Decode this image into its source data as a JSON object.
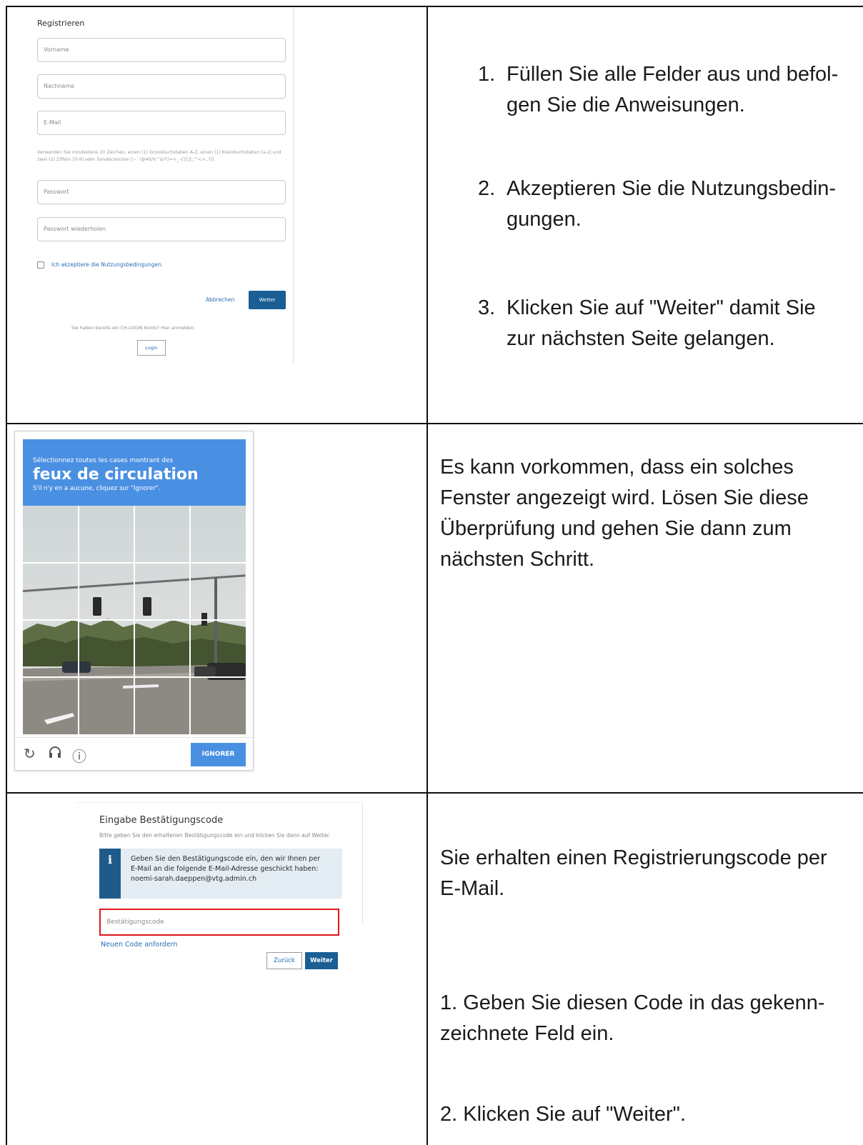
{
  "registration": {
    "title": "Registrieren",
    "fields": [
      "Vorname",
      "Nachname",
      "E-Mail",
      "Passwort",
      "Passwort wiederholen"
    ],
    "password_hint": "Verwenden Sie mindestens 10 Zeichen, einen (1) Grossbuchstaben A-Z, einen (1) Kleinbuchstaben [a-z] und zwei (2) Ziffern [0-9] oder Sonderzeichen [~`!@#$%^&*()=+_-{}[]|:;\"'<>,.?/]",
    "checkbox_label": "Ich akzeptiere die Nutzungsbedingungen.",
    "cancel_label": "Abbrechen",
    "next_label": "Weiter",
    "login_text": "Sie haben bereits ein CH-LOGIN Konto? Hier anmelden.",
    "login_button": "Login"
  },
  "instructions_1": [
    {
      "num": "1.",
      "text": "Füllen Sie alle Felder aus und befol-gen Sie die Anweisungen."
    },
    {
      "num": "2.",
      "text": "Akzeptieren Sie die Nutzungsbedin-gungen."
    },
    {
      "num": "3.",
      "text": "Klicken Sie auf \"Weiter\" damit Sie zur nächsten Seite gelangen."
    }
  ],
  "captcha": {
    "intro": "Sélectionnez toutes les cases montrant des",
    "target": "feux de circulation",
    "sub": "S'il n'y en a aucune, cliquez sur \"Ignorer\".",
    "reload_icon": "reload-icon",
    "audio_icon": "headphones-icon",
    "info_icon": "info-icon",
    "ignore_label": "IGNORER",
    "brand_color": "#4a90e2"
  },
  "text_2": "Es kann vorkommen, dass ein solches Fenster angezeigt wird. Lösen Sie diese Überprüfung und gehen Sie dann zum nächsten Schritt.",
  "confirmation": {
    "title": "Eingabe Bestätigungscode",
    "desc": "Bitte geben Sie den erhaltenen Bestätigungscode ein und klicken Sie dann auf Weiter.",
    "info_line1": "Geben Sie den Bestätigungscode ein, den wir Ihnen per",
    "info_line2": "E-Mail an die folgende E-Mail-Adresse geschickt haben:",
    "info_line3": "noemi-sarah.daeppen@vtg.admin.ch",
    "field_placeholder": "Bestätigungscode",
    "new_code_link": "Neuen Code anfordern",
    "back_label": "Zurück",
    "next_label": "Weiter",
    "highlight_color": "#e0161b"
  },
  "text_3": {
    "intro": "Sie erhalten einen Registrierungscode per E-Mail.",
    "step1": "1. Geben Sie diesen Code in das gekenn-zeichnete Feld ein.",
    "step2": "2. Klicken Sie auf \"Weiter\"."
  }
}
